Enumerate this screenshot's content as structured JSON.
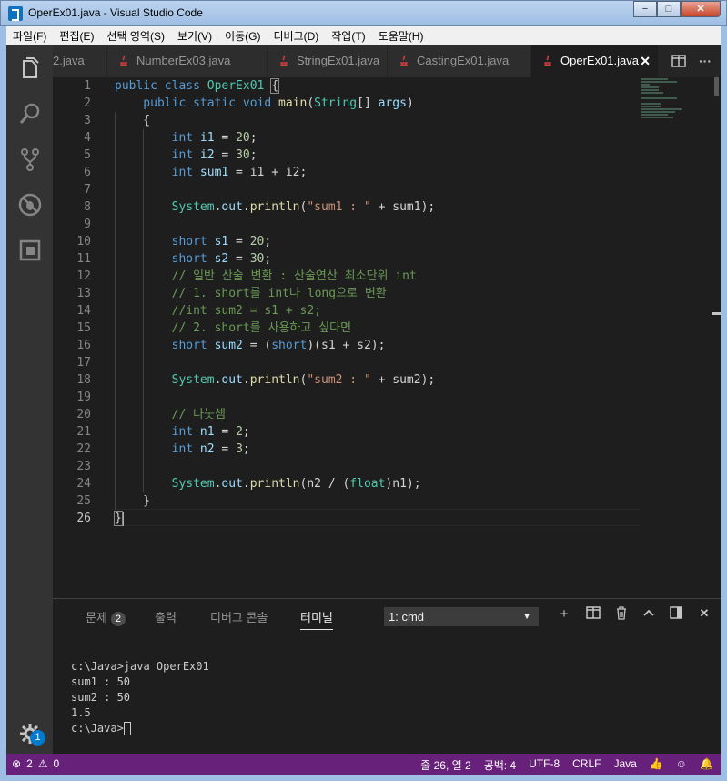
{
  "window": {
    "title": "OperEx01.java - Visual Studio Code",
    "min_label": "−",
    "max_label": "□",
    "close_label": "✕"
  },
  "menu": [
    "파일(F)",
    "편집(E)",
    "선택 영역(S)",
    "보기(V)",
    "이동(G)",
    "디버그(D)",
    "작업(T)",
    "도움말(H)"
  ],
  "tabs": [
    {
      "label": "2.java",
      "active": false
    },
    {
      "label": "NumberEx03.java",
      "active": false
    },
    {
      "label": "StringEx01.java",
      "active": false
    },
    {
      "label": "CastingEx01.java",
      "active": false
    },
    {
      "label": "OperEx01.java",
      "active": true
    }
  ],
  "tab_close": "✕",
  "tab_actions": [
    "split-editor-icon",
    "more-icon"
  ],
  "more_label": "···",
  "editor": {
    "current_line": 26,
    "line_numbers": [
      "1",
      "2",
      "3",
      "4",
      "5",
      "6",
      "7",
      "8",
      "9",
      "10",
      "11",
      "12",
      "13",
      "14",
      "15",
      "16",
      "17",
      "18",
      "19",
      "20",
      "21",
      "22",
      "23",
      "24",
      "25",
      "26"
    ]
  },
  "panel": {
    "tabs": [
      "문제",
      "출력",
      "디버그 콘솔",
      "터미널"
    ],
    "problems_count": "2",
    "terminal_select": "1: cmd",
    "terminal_lines": [
      "",
      "c:\\Java>java OperEx01",
      "sum1 : 50",
      "sum2 : 50",
      "1.5",
      "",
      "c:\\Java>"
    ]
  },
  "status": {
    "errors": "2",
    "warnings": "0",
    "position": "줄 26, 열 2",
    "indent": "공백: 4",
    "encoding": "UTF-8",
    "eol": "CRLF",
    "language": "Java"
  },
  "notifications": "1",
  "colors": {
    "status_bar": "#68217a",
    "editor_bg": "#1e1e1e",
    "activity_bar": "#333333"
  }
}
